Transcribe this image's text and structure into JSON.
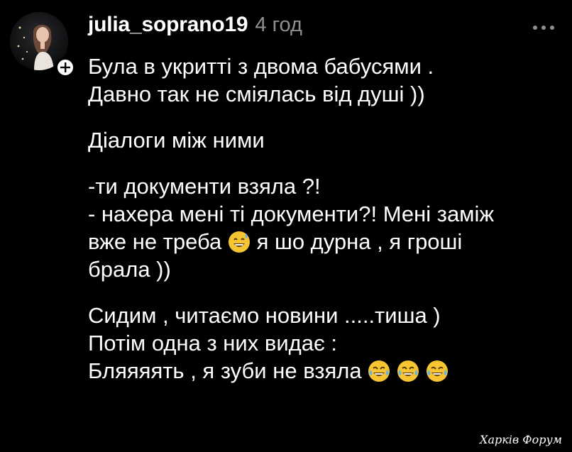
{
  "comment": {
    "username": "julia_soprano19",
    "timestamp": "4 год",
    "lines": {
      "l1": "Була в укритті з двома бабусями .",
      "l2": "Давно так не сміялась від душі ))",
      "l3": "Діалоги між ними",
      "l4": "-ти документи взяла ?!",
      "l5": "- нахера мені ті документи?! Мені заміж",
      "l6a": "вже не треба",
      "l6b": "я шо дурна , я гроші",
      "l7": "брала ))",
      "l8": "Сидим , читаємо новини .....тиша )",
      "l9": "Потім одна з них видає :",
      "l10": "Бляяяять , я зуби не взяла"
    }
  },
  "icons": {
    "follow": "plus-icon",
    "more": "more-dots-icon",
    "emoji_sweat": "grinning-sweat-emoji",
    "emoji_tears": "tears-of-joy-emoji"
  },
  "colors": {
    "background": "#000000",
    "text": "#ffffff",
    "muted": "#8e8e8e",
    "emoji_yellow": "#f7c531",
    "tear_blue": "#5fb3f0"
  },
  "watermark": "Харків Форум"
}
